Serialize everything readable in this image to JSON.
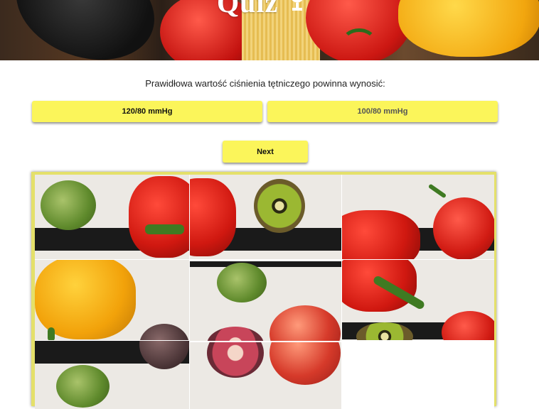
{
  "header": {
    "title": "Quiz",
    "icon": "trophy-icon"
  },
  "quiz": {
    "question": "Prawidłowa wartość ciśnienia tętniczego powinna wynosić:",
    "answers": [
      {
        "label": "120/80 mmHg"
      },
      {
        "label": "100/80 mmHg"
      }
    ],
    "next_label": "Next"
  },
  "colors": {
    "button_yellow": "#fbf55a",
    "puzzle_border": "#e4e06a"
  },
  "puzzle": {
    "grid": "3x3",
    "empty_slot": "bottom-right"
  }
}
